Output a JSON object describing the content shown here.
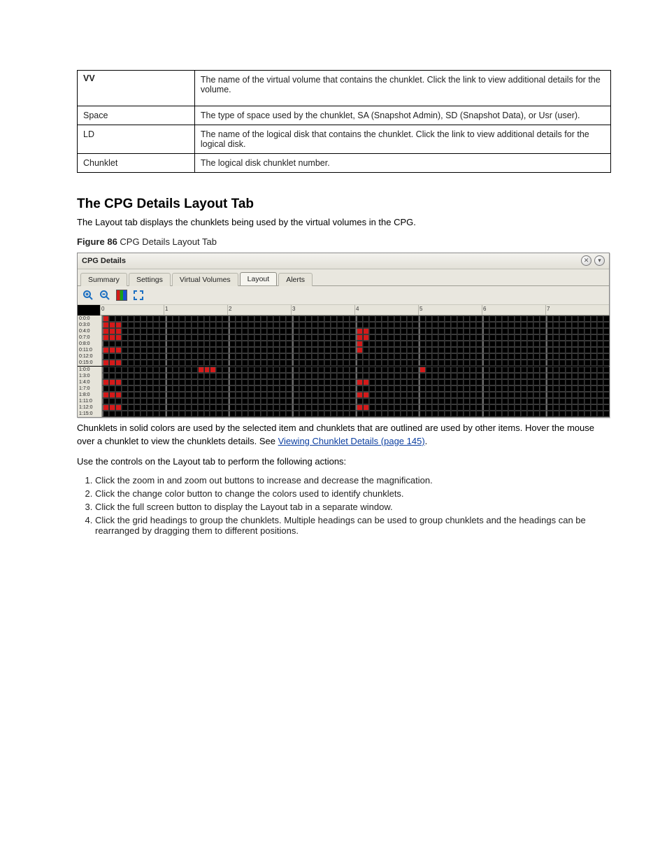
{
  "top_table": [
    {
      "k": "VV",
      "bold": true,
      "v": "The name of the virtual volume that contains the chunklet. Click the link to view additional details for the volume."
    },
    {
      "k": "Space",
      "bold": false,
      "v": "The type of space used by the chunklet, SA (Snapshot Admin), SD (Snapshot Data), or Usr (user)."
    },
    {
      "k": "LD",
      "bold": false,
      "v": "The name of the logical disk that contains the chunklet. Click the link to view additional details for the logical disk."
    },
    {
      "k": "Chunklet",
      "bold": false,
      "v": "The logical disk chunklet number."
    }
  ],
  "section": {
    "title": "The CPG Details Layout Tab",
    "p1": "The Layout tab displays the chunklets being used by the virtual volumes in the CPG.",
    "figcap_prefix": "Figure 86 ",
    "figcap": "CPG Details Layout Tab"
  },
  "panel": {
    "title": "CPG Details",
    "tabs": [
      "Summary",
      "Settings",
      "Virtual Volumes",
      "Layout",
      "Alerts"
    ],
    "active_tab": 3,
    "toolbar": {
      "zoom_in": "zoom-in-icon",
      "zoom_out": "zoom-out-icon",
      "legend": "change-color-icon",
      "expand": "full-screen-icon"
    }
  },
  "after": {
    "p1_a": "Chunklets in solid colors are used by the selected item and chunklets that are outlined are used by other items. Hover the mouse over a chunklet to view the chunklets details. See ",
    "p1_link": "Viewing Chunklet Details (page 145)",
    "p1_b": ".",
    "p2": "Use the controls on the Layout tab to perform the following actions:",
    "list": [
      "Click the zoom in and zoom out buttons to increase and decrease the magnification.",
      "Click the change color button to change the colors used to identify chunklets.",
      "Click the full screen button to display the Layout tab in a separate window.",
      "Click the grid headings to group the chunklets. Multiple headings can be used to group chunklets and the headings can be rearranged by dragging them to different positions."
    ]
  },
  "chart_data": {
    "type": "heatmap",
    "title": "CPG chunklet layout",
    "x_index_range": [
      0,
      79
    ],
    "row_labels": [
      "0:0:0",
      "0:3:0",
      "0:4:0",
      "0:7:0",
      "0:8:0",
      "0:11:0",
      "0:12:0",
      "0:15:0",
      "1:0:0",
      "1:3:0",
      "1:4:0",
      "1:7:0",
      "1:8:0",
      "1:11:0",
      "1:12:0",
      "1:15:0"
    ],
    "col_major_ticks": [
      0,
      10,
      20,
      30,
      40,
      50,
      60,
      70
    ],
    "legend": {
      "filled": "used by selected item",
      "outlined": "used by other items"
    },
    "rows": [
      {
        "id": "0:0:0",
        "filled": [
          0
        ]
      },
      {
        "id": "0:3:0",
        "filled": [
          0,
          1,
          2
        ]
      },
      {
        "id": "0:4:0",
        "filled": [
          0,
          1,
          2,
          40,
          41
        ]
      },
      {
        "id": "0:7:0",
        "filled": [
          0,
          1,
          2,
          40,
          41
        ]
      },
      {
        "id": "0:8:0",
        "filled": [
          40
        ]
      },
      {
        "id": "0:11:0",
        "filled": [
          0,
          1,
          2,
          40
        ]
      },
      {
        "id": "0:12:0",
        "filled": []
      },
      {
        "id": "0:15:0",
        "filled": [
          0,
          1,
          2
        ]
      },
      {
        "id": "1:0:0",
        "filled": [
          15,
          16,
          17,
          50
        ]
      },
      {
        "id": "1:3:0",
        "filled": []
      },
      {
        "id": "1:4:0",
        "filled": [
          0,
          1,
          2,
          40,
          41
        ]
      },
      {
        "id": "1:7:0",
        "filled": []
      },
      {
        "id": "1:8:0",
        "filled": [
          0,
          1,
          2,
          40,
          41
        ]
      },
      {
        "id": "1:11:0",
        "filled": []
      },
      {
        "id": "1:12:0",
        "filled": [
          0,
          1,
          2,
          40,
          41
        ]
      },
      {
        "id": "1:15:0",
        "filled": []
      }
    ]
  }
}
